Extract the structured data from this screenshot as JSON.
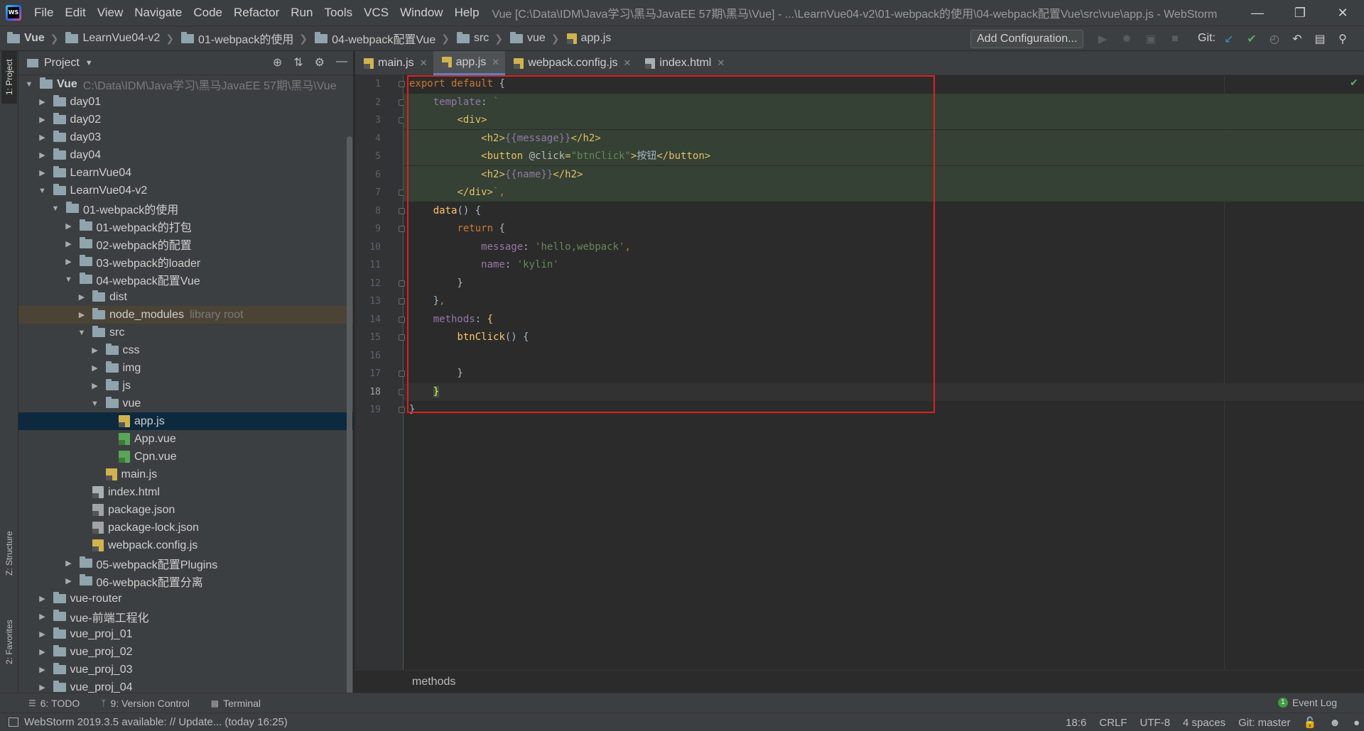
{
  "menu": {
    "items": [
      "File",
      "Edit",
      "View",
      "Navigate",
      "Code",
      "Refactor",
      "Run",
      "Tools",
      "VCS",
      "Window",
      "Help"
    ],
    "window_title": "Vue [C:\\Data\\IDM\\Java学习\\黑马JavaEE 57期\\黑马\\Vue] - ...\\LearnVue04-v2\\01-webpack的使用\\04-webpack配置Vue\\src\\vue\\app.js - WebStorm"
  },
  "navbar": {
    "crumbs": [
      "Vue",
      "LearnVue04-v2",
      "01-webpack的使用",
      "04-webpack配置Vue",
      "src",
      "vue",
      "app.js"
    ],
    "add_config": "Add Configuration...",
    "git_label": "Git:"
  },
  "left_strip": {
    "project": "1: Project",
    "structure": "Z: Structure",
    "favorites": "2: Favorites"
  },
  "project_panel": {
    "title": "Project",
    "tree": [
      {
        "name": "Vue",
        "hint": "C:\\Data\\IDM\\Java学习\\黑马JavaEE 57期\\黑马\\Vue",
        "depth": 0,
        "open": true,
        "type": "folder"
      },
      {
        "name": "day01",
        "hint": "",
        "depth": 1,
        "open": false,
        "type": "folder"
      },
      {
        "name": "day02",
        "hint": "",
        "depth": 1,
        "open": false,
        "type": "folder"
      },
      {
        "name": "day03",
        "hint": "",
        "depth": 1,
        "open": false,
        "type": "folder"
      },
      {
        "name": "day04",
        "hint": "",
        "depth": 1,
        "open": false,
        "type": "folder"
      },
      {
        "name": "LearnVue04",
        "hint": "",
        "depth": 1,
        "open": false,
        "type": "folder"
      },
      {
        "name": "LearnVue04-v2",
        "hint": "",
        "depth": 1,
        "open": true,
        "type": "folder"
      },
      {
        "name": "01-webpack的使用",
        "hint": "",
        "depth": 2,
        "open": true,
        "type": "folder"
      },
      {
        "name": "01-webpack的打包",
        "hint": "",
        "depth": 3,
        "open": false,
        "type": "folder"
      },
      {
        "name": "02-webpack的配置",
        "hint": "",
        "depth": 3,
        "open": false,
        "type": "folder"
      },
      {
        "name": "03-webpack的loader",
        "hint": "",
        "depth": 3,
        "open": false,
        "type": "folder"
      },
      {
        "name": "04-webpack配置Vue",
        "hint": "",
        "depth": 3,
        "open": true,
        "type": "folder"
      },
      {
        "name": "dist",
        "hint": "",
        "depth": 4,
        "open": false,
        "type": "folder"
      },
      {
        "name": "node_modules",
        "hint": "library root",
        "depth": 4,
        "open": false,
        "type": "folder",
        "highlight": true
      },
      {
        "name": "src",
        "hint": "",
        "depth": 4,
        "open": true,
        "type": "folder"
      },
      {
        "name": "css",
        "hint": "",
        "depth": 5,
        "open": false,
        "type": "folder"
      },
      {
        "name": "img",
        "hint": "",
        "depth": 5,
        "open": false,
        "type": "folder"
      },
      {
        "name": "js",
        "hint": "",
        "depth": 5,
        "open": false,
        "type": "folder"
      },
      {
        "name": "vue",
        "hint": "",
        "depth": 5,
        "open": true,
        "type": "folder"
      },
      {
        "name": "app.js",
        "hint": "",
        "depth": 6,
        "type": "js",
        "selected": true
      },
      {
        "name": "App.vue",
        "hint": "",
        "depth": 6,
        "type": "vue"
      },
      {
        "name": "Cpn.vue",
        "hint": "",
        "depth": 6,
        "type": "vue"
      },
      {
        "name": "main.js",
        "hint": "",
        "depth": 5,
        "type": "js"
      },
      {
        "name": "index.html",
        "hint": "",
        "depth": 4,
        "type": "html"
      },
      {
        "name": "package.json",
        "hint": "",
        "depth": 4,
        "type": "json"
      },
      {
        "name": "package-lock.json",
        "hint": "",
        "depth": 4,
        "type": "json"
      },
      {
        "name": "webpack.config.js",
        "hint": "",
        "depth": 4,
        "type": "js"
      },
      {
        "name": "05-webpack配置Plugins",
        "hint": "",
        "depth": 3,
        "open": false,
        "type": "folder"
      },
      {
        "name": "06-webpack配置分离",
        "hint": "",
        "depth": 3,
        "open": false,
        "type": "folder"
      },
      {
        "name": "vue-router",
        "hint": "",
        "depth": 1,
        "open": false,
        "type": "folder"
      },
      {
        "name": "vue-前端工程化",
        "hint": "",
        "depth": 1,
        "open": false,
        "type": "folder"
      },
      {
        "name": "vue_proj_01",
        "hint": "",
        "depth": 1,
        "open": false,
        "type": "folder"
      },
      {
        "name": "vue_proj_02",
        "hint": "",
        "depth": 1,
        "open": false,
        "type": "folder"
      },
      {
        "name": "vue_proj_03",
        "hint": "",
        "depth": 1,
        "open": false,
        "type": "folder"
      },
      {
        "name": "vue_proj_04",
        "hint": "",
        "depth": 1,
        "open": false,
        "type": "folder"
      }
    ]
  },
  "editor_tabs": [
    {
      "label": "main.js",
      "type": "js",
      "active": false
    },
    {
      "label": "app.js",
      "type": "js",
      "active": true
    },
    {
      "label": "webpack.config.js",
      "type": "js",
      "active": false
    },
    {
      "label": "index.html",
      "type": "html",
      "active": false
    }
  ],
  "editor": {
    "current_line": 18,
    "lines": [
      [
        [
          "kw",
          "export default "
        ],
        [
          "plain",
          "{"
        ]
      ],
      [
        [
          "plain",
          "    "
        ],
        [
          "prop",
          "template"
        ],
        [
          "plain",
          ": "
        ],
        [
          "str",
          "`"
        ]
      ],
      [
        [
          "plain",
          "        "
        ],
        [
          "tag",
          "<div>"
        ]
      ],
      [
        [
          "plain",
          "            "
        ],
        [
          "tag",
          "<h2>"
        ],
        [
          "interp",
          "{{message}}"
        ],
        [
          "tag",
          "</h2>"
        ]
      ],
      [
        [
          "plain",
          "            "
        ],
        [
          "tag",
          "<button "
        ],
        [
          "attr",
          "@click"
        ],
        [
          "tag",
          "="
        ],
        [
          "str",
          "\"btnClick\""
        ],
        [
          "tag",
          ">"
        ],
        [
          "plain",
          "按钮"
        ],
        [
          "tag",
          "</button>"
        ]
      ],
      [
        [
          "plain",
          "            "
        ],
        [
          "tag",
          "<h2>"
        ],
        [
          "interp",
          "{{name}}"
        ],
        [
          "tag",
          "</h2>"
        ]
      ],
      [
        [
          "plain",
          "        "
        ],
        [
          "tag",
          "</div>"
        ],
        [
          "str",
          "`"
        ],
        [
          "kw",
          ","
        ]
      ],
      [
        [
          "plain",
          "    "
        ],
        [
          "fn",
          "data"
        ],
        [
          "plain",
          "() {"
        ]
      ],
      [
        [
          "plain",
          "        "
        ],
        [
          "kw",
          "return "
        ],
        [
          "plain",
          "{"
        ]
      ],
      [
        [
          "plain",
          "            "
        ],
        [
          "prop",
          "message"
        ],
        [
          "plain",
          ": "
        ],
        [
          "str",
          "'hello,webpack'"
        ],
        [
          "kw",
          ","
        ]
      ],
      [
        [
          "plain",
          "            "
        ],
        [
          "prop",
          "name"
        ],
        [
          "plain",
          ": "
        ],
        [
          "str",
          "'kylin'"
        ]
      ],
      [
        [
          "plain",
          "        }"
        ]
      ],
      [
        [
          "plain",
          "    }"
        ],
        [
          "kw",
          ","
        ]
      ],
      [
        [
          "plain",
          "    "
        ],
        [
          "prop",
          "methods"
        ],
        [
          "plain",
          ": "
        ],
        [
          "fn",
          "{"
        ]
      ],
      [
        [
          "plain",
          "        "
        ],
        [
          "fn",
          "btnClick"
        ],
        [
          "plain",
          "() {"
        ]
      ],
      [
        [
          "plain",
          ""
        ]
      ],
      [
        [
          "plain",
          "        }"
        ]
      ],
      [
        [
          "plain",
          "    "
        ],
        [
          "brace",
          "}"
        ]
      ],
      [
        [
          "plain",
          "}"
        ]
      ]
    ],
    "breadcrumb": "methods"
  },
  "tool_windows": {
    "todo": "6: TODO",
    "vcs": "9: Version Control",
    "terminal": "Terminal",
    "event_log": "Event Log",
    "event_count": "1"
  },
  "status": {
    "message": "WebStorm 2019.3.5 available: // Update... (today 16:25)",
    "position": "18:6",
    "line_sep": "CRLF",
    "encoding": "UTF-8",
    "indent": "4 spaces",
    "git": "Git: master"
  }
}
